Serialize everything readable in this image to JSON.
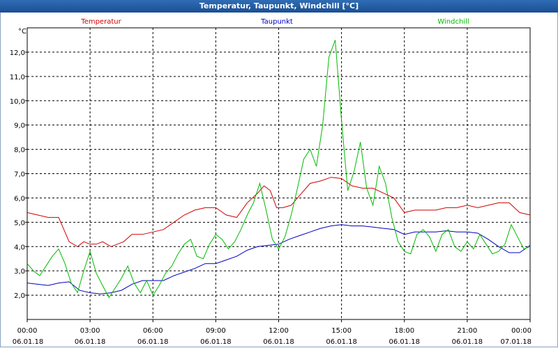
{
  "window": {
    "title": "Temperatur, Taupunkt, Windchill [°C]"
  },
  "chart_data": {
    "type": "line",
    "title": "Temperatur, Taupunkt, Windchill [°C]",
    "ylabel": "°C",
    "ylim": [
      1.0,
      13.0
    ],
    "xlim": [
      0,
      24
    ],
    "grid": true,
    "legend_position": "top",
    "y_ticks": [
      "2,0",
      "3,0",
      "4,0",
      "5,0",
      "6,0",
      "7,0",
      "8,0",
      "9,0",
      "10,0",
      "11,0",
      "12,0"
    ],
    "x_ticks": [
      {
        "h": 0,
        "time": "00:00",
        "date": "06.01.18"
      },
      {
        "h": 3,
        "time": "03:00",
        "date": "06.01.18"
      },
      {
        "h": 6,
        "time": "06:00",
        "date": "06.01.18"
      },
      {
        "h": 9,
        "time": "09:00",
        "date": "06.01.18"
      },
      {
        "h": 12,
        "time": "12:00",
        "date": "06.01.18"
      },
      {
        "h": 15,
        "time": "15:00",
        "date": "06.01.18"
      },
      {
        "h": 18,
        "time": "18:00",
        "date": "06.01.18"
      },
      {
        "h": 21,
        "time": "21:00",
        "date": "06.01.18"
      },
      {
        "h": 24,
        "time": "00:00",
        "date": "07.01.18"
      }
    ],
    "series": [
      {
        "name": "Temperatur",
        "color": "#d00000",
        "x": [
          0,
          0.5,
          1,
          1.5,
          1.8,
          2,
          2.4,
          2.7,
          3,
          3.3,
          3.6,
          4,
          4.3,
          4.6,
          5,
          5.5,
          6,
          6.5,
          7,
          7.5,
          8,
          8.5,
          9,
          9.5,
          10,
          10.5,
          11,
          11.3,
          11.6,
          11.9,
          12.2,
          12.6,
          13,
          13.5,
          14,
          14.5,
          15,
          15.5,
          16,
          16.5,
          17,
          17.5,
          18,
          18.5,
          19,
          19.5,
          20,
          20.5,
          21,
          21.5,
          22,
          22.5,
          23,
          23.5,
          24
        ],
        "values": [
          5.4,
          5.3,
          5.2,
          5.2,
          4.6,
          4.2,
          4.0,
          4.2,
          4.1,
          4.1,
          4.2,
          4.0,
          4.1,
          4.2,
          4.5,
          4.5,
          4.6,
          4.7,
          5.0,
          5.3,
          5.5,
          5.6,
          5.6,
          5.3,
          5.2,
          5.8,
          6.2,
          6.5,
          6.3,
          5.6,
          5.6,
          5.7,
          6.1,
          6.6,
          6.7,
          6.85,
          6.8,
          6.5,
          6.4,
          6.4,
          6.2,
          6.0,
          5.4,
          5.5,
          5.5,
          5.5,
          5.6,
          5.6,
          5.7,
          5.6,
          5.7,
          5.8,
          5.8,
          5.4,
          5.3
        ]
      },
      {
        "name": "Taupunkt",
        "color": "#0000c0",
        "x": [
          0,
          0.5,
          1,
          1.5,
          2,
          2.5,
          3,
          3.5,
          4,
          4.5,
          5,
          5.5,
          6,
          6.5,
          7,
          7.5,
          8,
          8.5,
          9,
          9.5,
          10,
          10.5,
          11,
          11.5,
          12,
          12.5,
          13,
          13.5,
          14,
          14.5,
          15,
          15.5,
          16,
          16.5,
          17,
          17.5,
          18,
          18.5,
          19,
          19.5,
          20,
          20.5,
          21,
          21.5,
          22,
          22.5,
          23,
          23.5,
          24
        ],
        "values": [
          2.5,
          2.45,
          2.4,
          2.5,
          2.55,
          2.2,
          2.1,
          2.05,
          2.1,
          2.2,
          2.45,
          2.6,
          2.6,
          2.6,
          2.8,
          2.95,
          3.1,
          3.3,
          3.3,
          3.45,
          3.6,
          3.85,
          4.0,
          4.05,
          4.1,
          4.3,
          4.45,
          4.6,
          4.75,
          4.85,
          4.9,
          4.85,
          4.85,
          4.8,
          4.75,
          4.7,
          4.5,
          4.6,
          4.6,
          4.6,
          4.65,
          4.6,
          4.6,
          4.55,
          4.3,
          4.0,
          3.75,
          3.75,
          4.05
        ]
      },
      {
        "name": "Windchill",
        "color": "#00bb00",
        "x": [
          0,
          0.3,
          0.6,
          0.9,
          1.2,
          1.5,
          1.8,
          2.1,
          2.4,
          2.7,
          3,
          3.3,
          3.6,
          3.9,
          4.2,
          4.5,
          4.8,
          5.1,
          5.4,
          5.7,
          6,
          6.3,
          6.6,
          6.9,
          7.2,
          7.5,
          7.8,
          8.1,
          8.4,
          8.7,
          9,
          9.3,
          9.6,
          9.9,
          10.2,
          10.5,
          10.8,
          11.1,
          11.4,
          11.7,
          12,
          12.3,
          12.6,
          12.9,
          13.2,
          13.5,
          13.8,
          14.1,
          14.4,
          14.7,
          15,
          15.3,
          15.6,
          15.9,
          16.2,
          16.5,
          16.8,
          17.1,
          17.4,
          17.7,
          18,
          18.3,
          18.6,
          18.9,
          19.2,
          19.5,
          19.8,
          20.1,
          20.4,
          20.7,
          21,
          21.3,
          21.6,
          21.9,
          22.2,
          22.5,
          22.8,
          23.1,
          23.4,
          23.7,
          24
        ],
        "values": [
          3.3,
          3.0,
          2.8,
          3.2,
          3.6,
          3.9,
          3.3,
          2.5,
          2.1,
          3.0,
          3.8,
          2.9,
          2.4,
          1.9,
          2.3,
          2.7,
          3.2,
          2.5,
          2.1,
          2.6,
          2.0,
          2.4,
          2.9,
          3.2,
          3.7,
          4.1,
          4.3,
          3.6,
          3.5,
          4.1,
          4.5,
          4.3,
          3.9,
          4.2,
          4.7,
          5.3,
          5.8,
          6.6,
          5.5,
          4.3,
          3.9,
          4.4,
          5.3,
          6.4,
          7.6,
          8.0,
          7.3,
          9.0,
          11.8,
          12.5,
          9.2,
          6.3,
          7.1,
          8.3,
          6.4,
          5.7,
          7.3,
          6.6,
          5.2,
          4.2,
          3.8,
          3.7,
          4.5,
          4.7,
          4.4,
          3.8,
          4.5,
          4.7,
          4.0,
          3.8,
          4.2,
          3.9,
          4.5,
          4.1,
          3.7,
          3.8,
          4.1,
          4.9,
          4.4,
          3.9,
          4.0
        ]
      }
    ]
  }
}
